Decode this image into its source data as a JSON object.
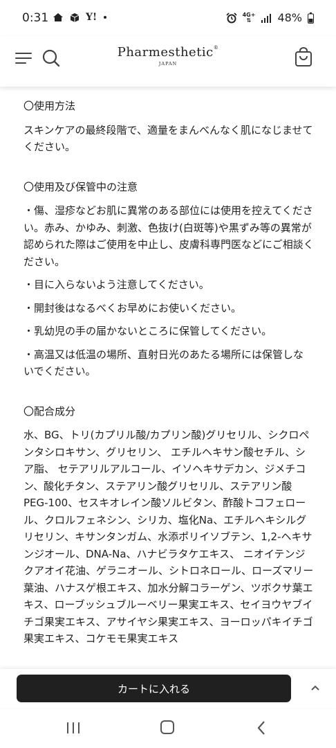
{
  "status_bar": {
    "time": "0:31",
    "left_icons": [
      "home-icon",
      "box-icon",
      "yahoo-icon",
      "dot-icon"
    ],
    "yahoo_label": "Y!",
    "network_label": "4G+",
    "battery": "48%"
  },
  "header": {
    "brand": "Pharmesthetic",
    "brand_mark": "®",
    "brand_sub": "JAPAN"
  },
  "sections": [
    {
      "title": "〇使用方法",
      "paragraphs": [
        "スキンケアの最終段階で、適量をまんべんなく肌になじませてください。"
      ]
    },
    {
      "title": "〇使用及び保管中の注意",
      "paragraphs": [
        "・傷、湿疹などお肌に異常のある部位には使用を控えてください。赤み、かゆみ、刺激、色抜け(白斑等)や黒ずみ等の異常が認められた際はご使用を中止し、皮膚科専門医などにご相談ください。",
        "・目に入らないよう注意してください。",
        "・開封後はなるべくお早めにお使いください。",
        "・乳幼児の手の届かないところに保管してください。",
        "・高温又は低温の場所、直射日光のあたる場所には保管しないでください。"
      ]
    },
    {
      "title": "〇配合成分",
      "paragraphs": [
        "水、BG、トリ(カプリル酸/カプリン酸)グリセリル、シクロペンタシロキサン、グリセリン、 エチルヘキサン酸セチル、シア脂、 セテアリルアルコール、イソヘキサデカン、ジメチコン、酸化チタン、ステアリン酸グリセリル、ステアリン酸PEG-100、セスキオレイン酸ソルビタン、酢酸トコフェロール、クロルフェネシン、シリカ、塩化Na、エチルヘキシルグリセリン、キサンタンガム、水添ポリイソブテン、1,2-ヘキサンジオール、DNA-Na、ハナビラタケエキス、 ニオイテンジクアオイ花油、ゲラニオール、シトロネロール、ローズマリー葉油、ハナスゲ根エキス、加水分解コラーゲン、ツボクサ葉エキス、ローブッシュブルーベリー果実エキス、セイヨウヤブイチゴ果実エキス、アサイヤシ果実エキス、ヨーロッパキイチゴ果実エキス、コケモモ果実エキス"
      ]
    }
  ],
  "bottom_bar": {
    "cart_button_label": "カートに入れる"
  },
  "nav_bar": {
    "icons": [
      "recents-icon",
      "home-button-icon",
      "back-icon"
    ]
  }
}
